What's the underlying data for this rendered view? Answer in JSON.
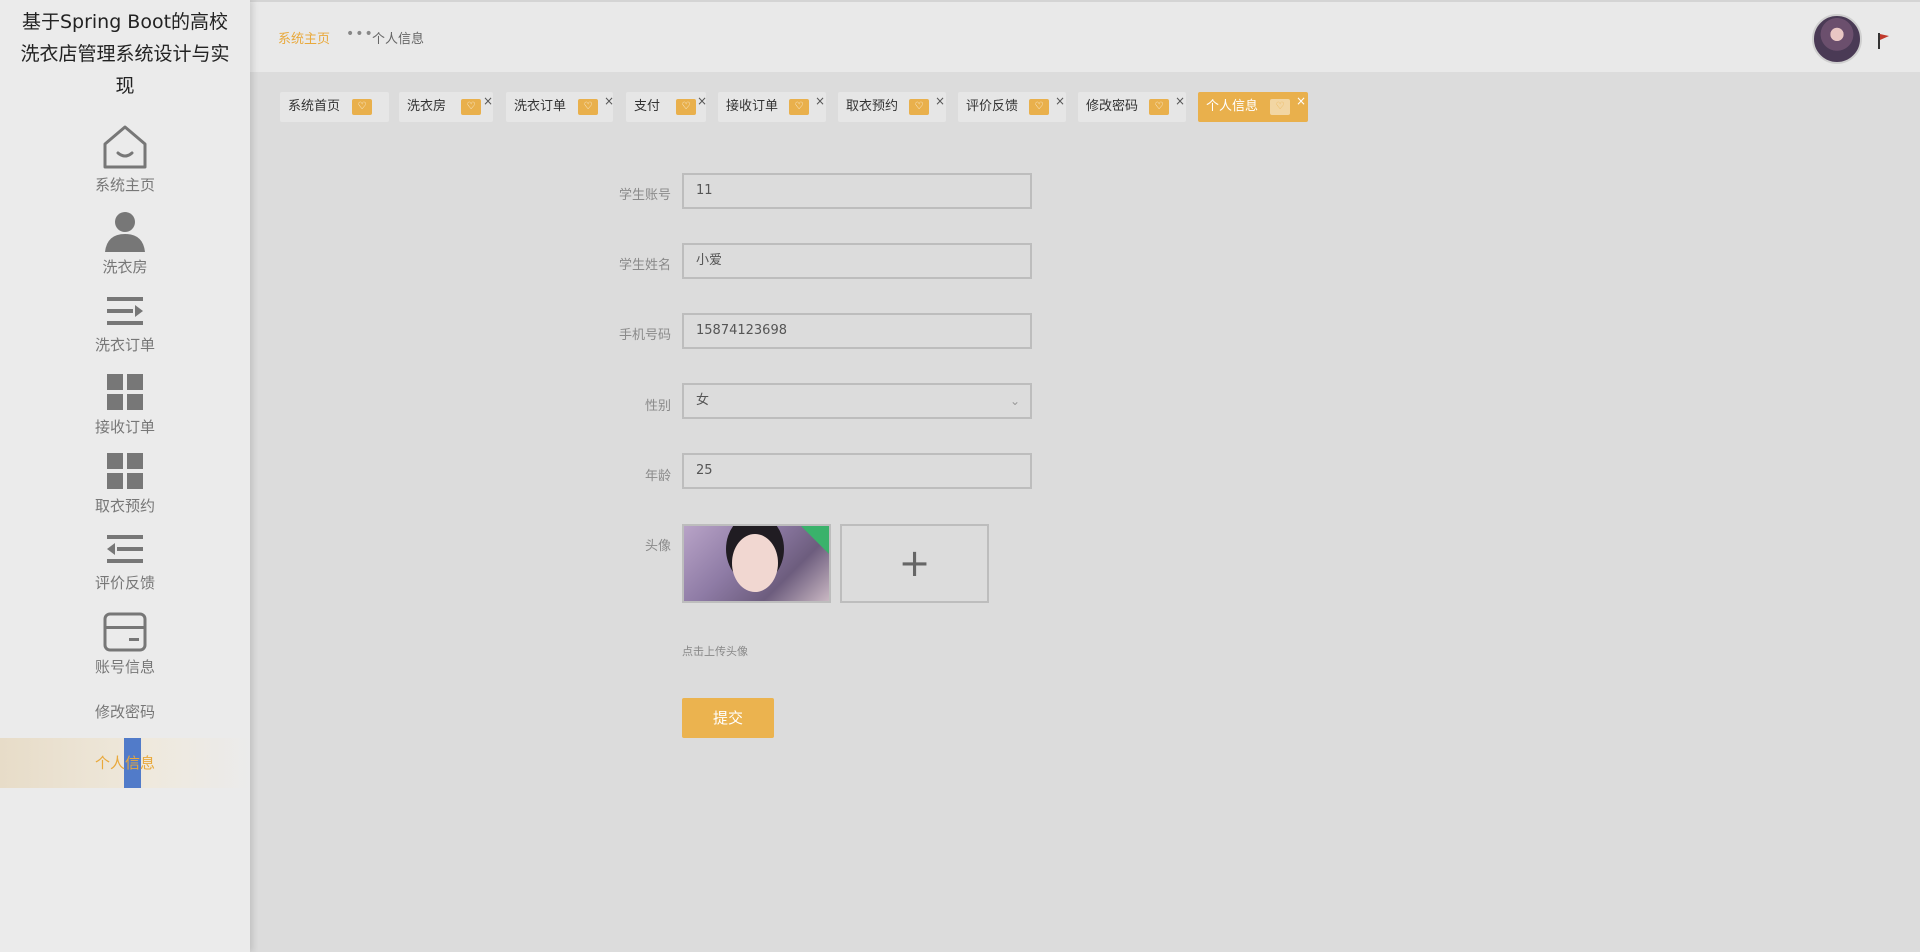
{
  "app": {
    "title": "基于Spring Boot的高校洗衣店管理系统设计与实现"
  },
  "sidebar": {
    "items": [
      {
        "label": "系统主页",
        "icon": "home-icon"
      },
      {
        "label": "洗衣房",
        "icon": "user-icon"
      },
      {
        "label": "洗衣订单",
        "icon": "list-icon"
      },
      {
        "label": "接收订单",
        "icon": "grid-icon"
      },
      {
        "label": "取衣预约",
        "icon": "grid-icon"
      },
      {
        "label": "评价反馈",
        "icon": "indent-icon"
      },
      {
        "label": "账号信息",
        "icon": "card-icon"
      },
      {
        "label": "修改密码",
        "icon": ""
      },
      {
        "label": "个人信息",
        "icon": "",
        "active": true
      }
    ]
  },
  "header": {
    "breadcrumb_home": "系统主页",
    "breadcrumb_sep": "•••",
    "breadcrumb_current": "个人信息"
  },
  "tabs": [
    {
      "label": "系统首页",
      "closable": false
    },
    {
      "label": "洗衣房",
      "closable": true
    },
    {
      "label": "洗衣订单",
      "closable": true
    },
    {
      "label": "支付",
      "closable": true
    },
    {
      "label": "接收订单",
      "closable": true
    },
    {
      "label": "取衣预约",
      "closable": true
    },
    {
      "label": "评价反馈",
      "closable": true
    },
    {
      "label": "修改密码",
      "closable": true
    },
    {
      "label": "个人信息",
      "closable": true,
      "active": true
    }
  ],
  "tab_heart": "♡",
  "tab_close": "×",
  "form": {
    "student_account": {
      "label": "学生账号",
      "value": "11"
    },
    "student_name": {
      "label": "学生姓名",
      "value": "小爱"
    },
    "phone": {
      "label": "手机号码",
      "value": "15874123698"
    },
    "gender": {
      "label": "性别",
      "value": "女"
    },
    "age": {
      "label": "年龄",
      "value": "25"
    },
    "avatar": {
      "label": "头像",
      "hint": "点击上传头像",
      "add_symbol": "+"
    },
    "submit_label": "提交"
  },
  "colors": {
    "accent": "#e9b04c",
    "sidebar_bg": "#ebebeb",
    "content_bg": "#dcdcdc",
    "selection": "#3f6fc7"
  }
}
